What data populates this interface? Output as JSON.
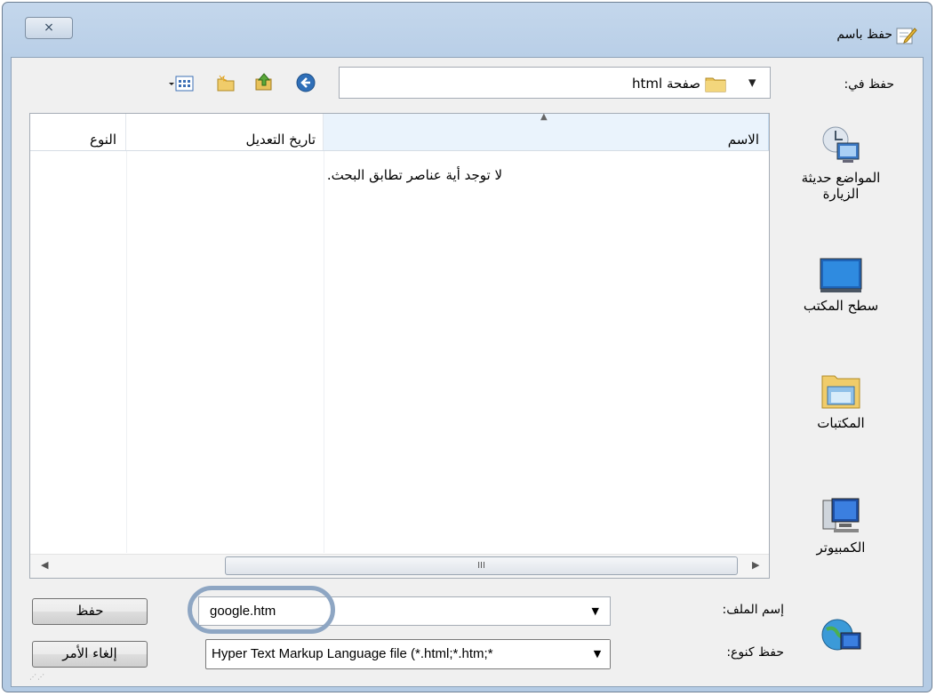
{
  "window": {
    "title": "حفظ باسم",
    "close_label": "⨯"
  },
  "save_in": {
    "label": "حفظ في:",
    "value": "صفحة html"
  },
  "toolbar": {
    "icons": [
      "back-icon",
      "up-folder-icon",
      "new-folder-icon",
      "view-menu-icon"
    ]
  },
  "places": [
    {
      "label": "المواضع حديثة الزيارة",
      "icon": "recent-places-icon"
    },
    {
      "label": "سطح المكتب",
      "icon": "desktop-icon"
    },
    {
      "label": "المكتبات",
      "icon": "libraries-icon"
    },
    {
      "label": "الكمبيوتر",
      "icon": "computer-icon"
    },
    {
      "label": "",
      "icon": "network-icon"
    }
  ],
  "list": {
    "columns": [
      "الاسم",
      "تاريخ التعديل",
      "النوع"
    ],
    "empty_message": "لا توجد أية عناصر تطابق البحث.",
    "scroll_grip": "III"
  },
  "file_name": {
    "label": "إسم الملف:",
    "value": "google.htm"
  },
  "save_as_type": {
    "label": "حفظ كنوع:",
    "value": "Hyper Text Markup Language file (*.html;*.htm;*"
  },
  "buttons": {
    "save": "حفظ",
    "cancel": "إلغاء الأمر"
  },
  "colors": {
    "frame": "#b9cfe7",
    "annotation": "#8ea6c3",
    "sorted_header": "#eaf3fc"
  }
}
